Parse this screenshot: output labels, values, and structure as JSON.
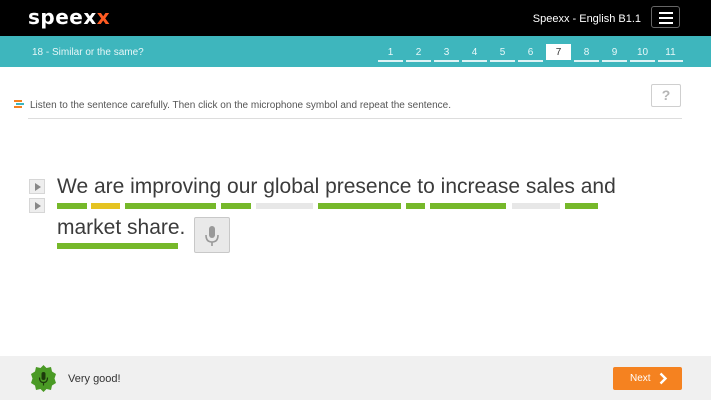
{
  "header": {
    "logo_main": "speex",
    "logo_accent": "x",
    "course_title": "Speexx - English B1.1"
  },
  "lesson": {
    "title": "18 - Similar or the same?",
    "pages": [
      "1",
      "2",
      "3",
      "4",
      "5",
      "6",
      "7",
      "8",
      "9",
      "10",
      "11"
    ],
    "active_page": "7"
  },
  "exercise": {
    "instruction": "Listen to the sentence carefully. Then click on the microphone symbol and repeat the sentence.",
    "help_label": "?",
    "sentence_line1": "We are improving our global presence to increase sales and",
    "sentence_line2": "market share.",
    "word_ratings": [
      {
        "word": "We",
        "rating": "good"
      },
      {
        "word": "are",
        "rating": "fair"
      },
      {
        "word": "improving",
        "rating": "good"
      },
      {
        "word": "our",
        "rating": "good"
      },
      {
        "word": "global",
        "rating": "none"
      },
      {
        "word": "presence",
        "rating": "good"
      },
      {
        "word": "to",
        "rating": "good"
      },
      {
        "word": "increase",
        "rating": "good"
      },
      {
        "word": "sales",
        "rating": "none"
      },
      {
        "word": "and",
        "rating": "good"
      },
      {
        "word": "market share.",
        "rating": "good"
      }
    ]
  },
  "footer": {
    "feedback": "Very good!",
    "next_label": "Next"
  },
  "colors": {
    "teal": "#3eb6bd",
    "good": "#76b82a",
    "fair": "#e5c321",
    "none": "#e7e7e7",
    "next": "#f58220",
    "logo_accent": "#ff5b22"
  }
}
